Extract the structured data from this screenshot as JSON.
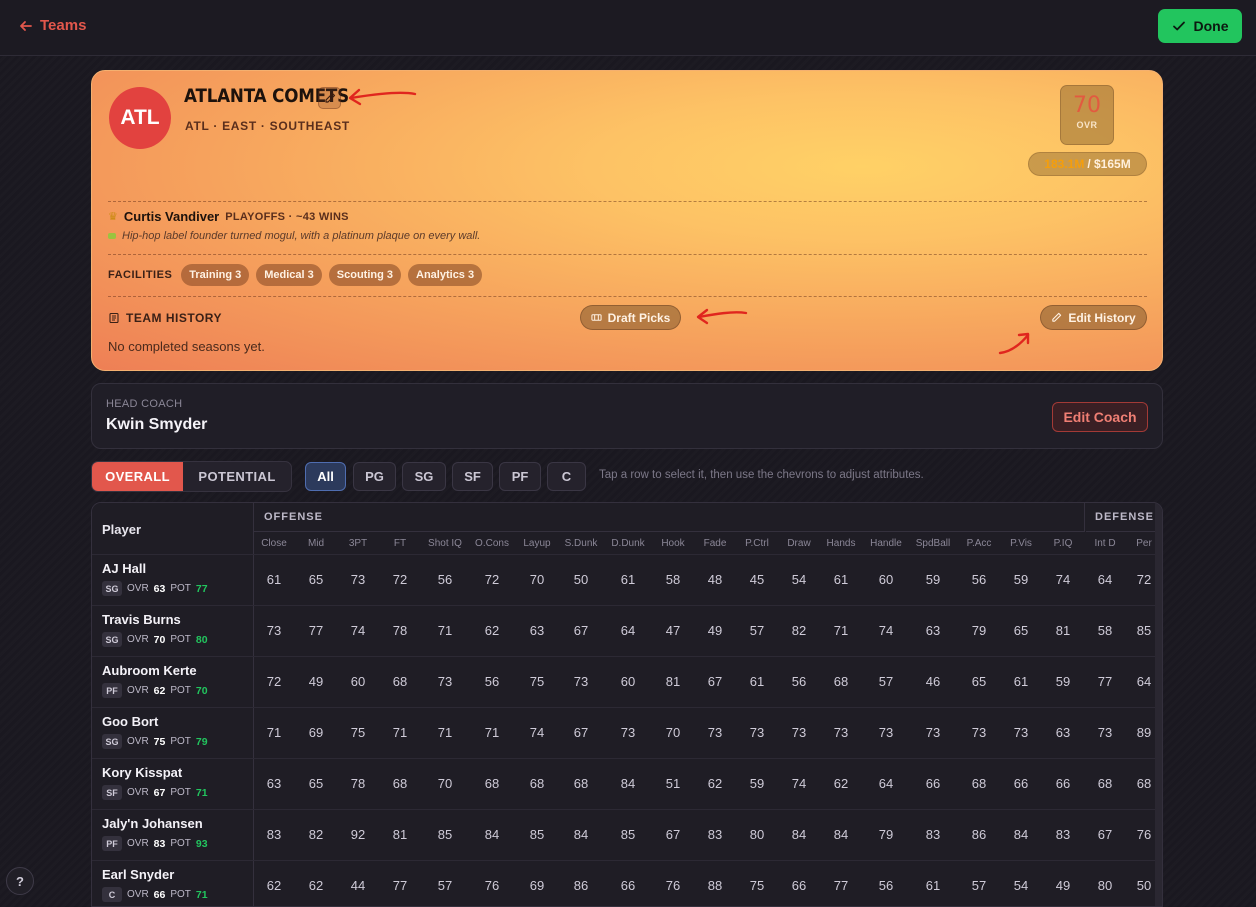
{
  "nav": {
    "back_label": "Teams",
    "done_label": "Done"
  },
  "team": {
    "abbrev": "ATL",
    "name": "ATLANTA COMETS",
    "subtitle": "ATL · EAST · SOUTHEAST",
    "ovr": "70",
    "ovr_label": "OVR",
    "payroll_used": "183.1M",
    "payroll_cap": "/ $165M",
    "owner_name": "Curtis Vandiver",
    "owner_status": "PLAYOFFS · ~43 WINS",
    "owner_bio": "Hip-hop label founder turned mogul, with a platinum plaque on every wall.",
    "facilities_label": "FACILITIES",
    "facilities": [
      "Training 3",
      "Medical 3",
      "Scouting 3",
      "Analytics 3"
    ],
    "history_label": "TEAM HISTORY",
    "history_empty": "No completed seasons yet.",
    "draft_picks_label": "Draft Picks",
    "edit_history_label": "Edit History"
  },
  "coach": {
    "label": "HEAD COACH",
    "name": "Kwin Smyder",
    "edit_label": "Edit Coach"
  },
  "filters": {
    "view_tabs": [
      "OVERALL",
      "POTENTIAL"
    ],
    "positions": [
      "All",
      "PG",
      "SG",
      "SF",
      "PF",
      "C"
    ],
    "hint": "Tap a row to select it, then use the chevrons to adjust attributes."
  },
  "table": {
    "player_header": "Player",
    "groups": [
      "OFFENSE",
      "DEFENSE"
    ],
    "columns": [
      "Close",
      "Mid",
      "3PT",
      "FT",
      "Shot IQ",
      "O.Cons",
      "Layup",
      "S.Dunk",
      "D.Dunk",
      "Hook",
      "Fade",
      "P.Ctrl",
      "Draw",
      "Hands",
      "Handle",
      "SpdBall",
      "P.Acc",
      "P.Vis",
      "P.IQ",
      "Int D",
      "Per"
    ],
    "players": [
      {
        "name": "AJ Hall",
        "pos": "SG",
        "ovr": "63",
        "pot": "77",
        "values": [
          "61",
          "65",
          "73",
          "72",
          "56",
          "72",
          "70",
          "50",
          "61",
          "58",
          "48",
          "45",
          "54",
          "61",
          "60",
          "59",
          "56",
          "59",
          "74",
          "64",
          "72"
        ]
      },
      {
        "name": "Travis Burns",
        "pos": "SG",
        "ovr": "70",
        "pot": "80",
        "values": [
          "73",
          "77",
          "74",
          "78",
          "71",
          "62",
          "63",
          "67",
          "64",
          "47",
          "49",
          "57",
          "82",
          "71",
          "74",
          "63",
          "79",
          "65",
          "81",
          "58",
          "85"
        ]
      },
      {
        "name": "Aubroom Kerte",
        "pos": "PF",
        "ovr": "62",
        "pot": "70",
        "values": [
          "72",
          "49",
          "60",
          "68",
          "73",
          "56",
          "75",
          "73",
          "60",
          "81",
          "67",
          "61",
          "56",
          "68",
          "57",
          "46",
          "65",
          "61",
          "59",
          "77",
          "64"
        ]
      },
      {
        "name": "Goo Bort",
        "pos": "SG",
        "ovr": "75",
        "pot": "79",
        "values": [
          "71",
          "69",
          "75",
          "71",
          "71",
          "71",
          "74",
          "67",
          "73",
          "70",
          "73",
          "73",
          "73",
          "73",
          "73",
          "73",
          "73",
          "73",
          "63",
          "73",
          "89"
        ]
      },
      {
        "name": "Kory Kisspat",
        "pos": "SF",
        "ovr": "67",
        "pot": "71",
        "values": [
          "63",
          "65",
          "78",
          "68",
          "70",
          "68",
          "68",
          "68",
          "84",
          "51",
          "62",
          "59",
          "74",
          "62",
          "64",
          "66",
          "68",
          "66",
          "66",
          "68",
          "68"
        ]
      },
      {
        "name": "Jaly'n Johansen",
        "pos": "PF",
        "ovr": "83",
        "pot": "93",
        "values": [
          "83",
          "82",
          "92",
          "81",
          "85",
          "84",
          "85",
          "84",
          "85",
          "67",
          "83",
          "80",
          "84",
          "84",
          "79",
          "83",
          "86",
          "84",
          "83",
          "67",
          "76"
        ]
      },
      {
        "name": "Earl Snyder",
        "pos": "C",
        "ovr": "66",
        "pot": "71",
        "values": [
          "62",
          "62",
          "44",
          "77",
          "57",
          "76",
          "69",
          "86",
          "66",
          "76",
          "88",
          "75",
          "66",
          "77",
          "56",
          "61",
          "57",
          "54",
          "49",
          "80",
          "50"
        ]
      }
    ],
    "ovr_label": "OVR",
    "pot_label": "POT"
  },
  "help_label": "?",
  "colors": {
    "accent": "#e2574c",
    "done": "#22c55e",
    "potential": "#22c55e"
  }
}
